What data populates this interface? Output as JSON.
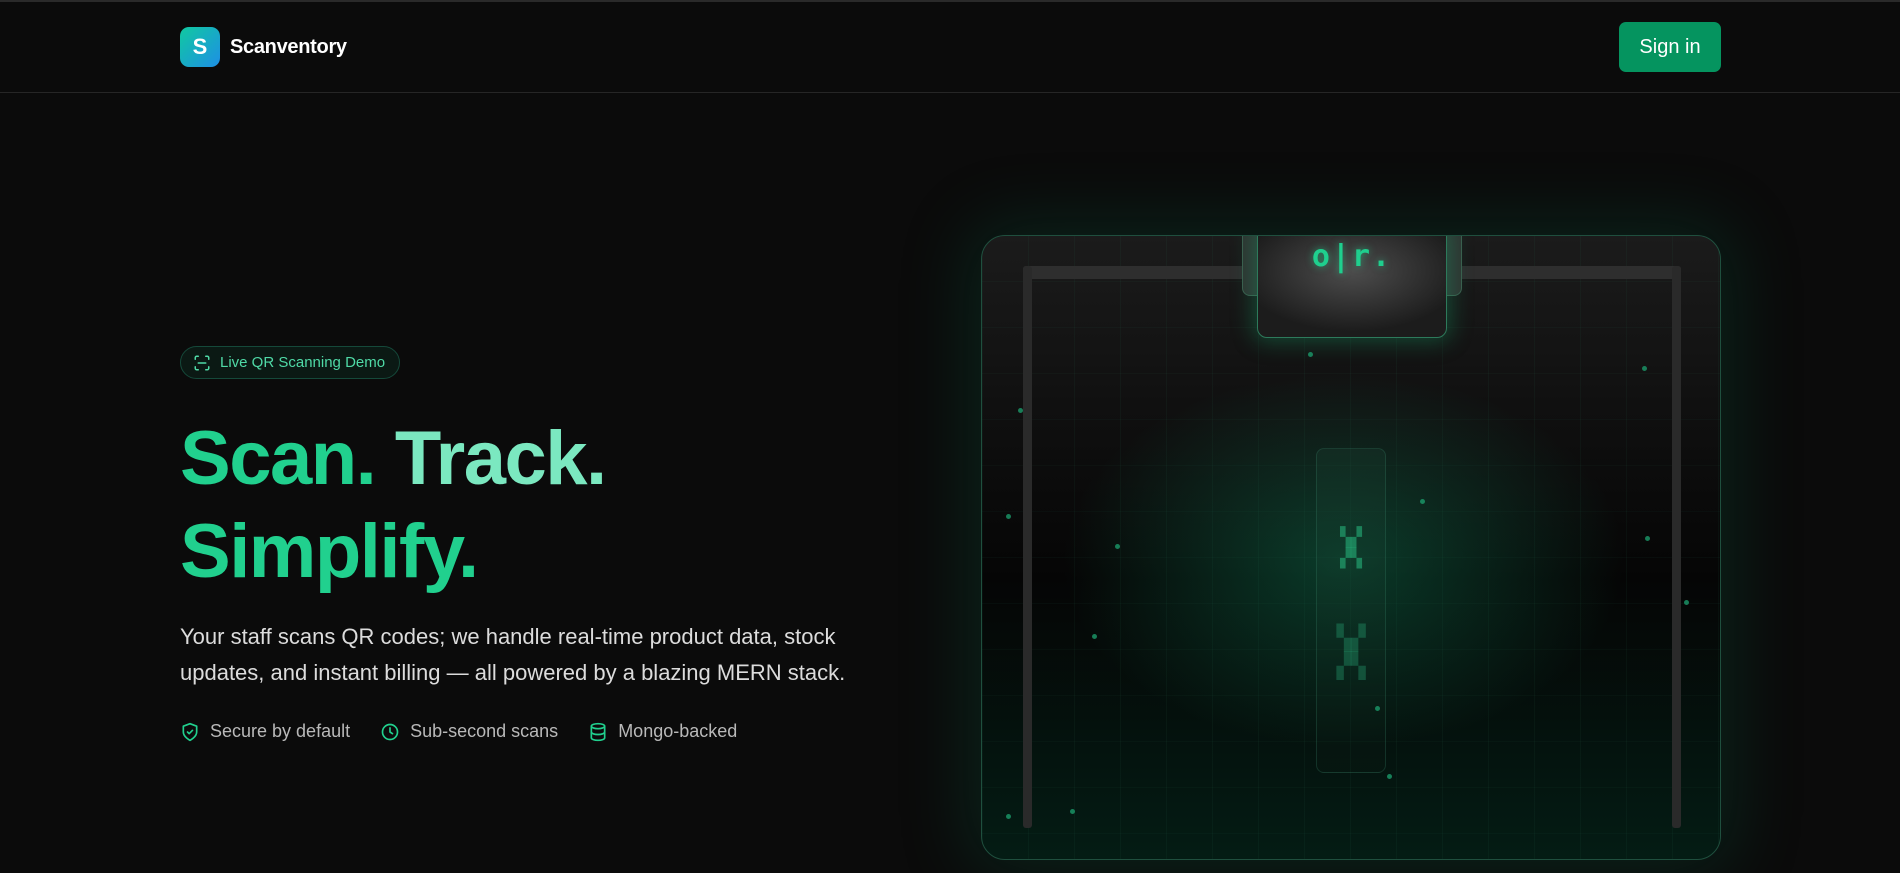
{
  "header": {
    "logo_letter": "S",
    "brand": "Scanventory",
    "signin_label": "Sign in"
  },
  "hero": {
    "badge_label": "Live QR Scanning Demo",
    "headline_line1_word1": "Scan.",
    "headline_line1_word2": "Track.",
    "headline_line2": "Simplify.",
    "subtitle": "Your staff scans QR codes; we handle real-time product data, stock updates, and instant billing — all powered by a blazing MERN stack.",
    "features": [
      {
        "icon": "shield-check-icon",
        "label": "Secure by default"
      },
      {
        "icon": "clock-icon",
        "label": "Sub-second scans"
      },
      {
        "icon": "database-icon",
        "label": "Mongo-backed"
      }
    ]
  },
  "visual": {
    "scanner_text": "o|r."
  },
  "colors": {
    "accent": "#21d08e",
    "accent_light": "#7be8c0",
    "button": "#05945f",
    "background": "#0b0b0b"
  }
}
